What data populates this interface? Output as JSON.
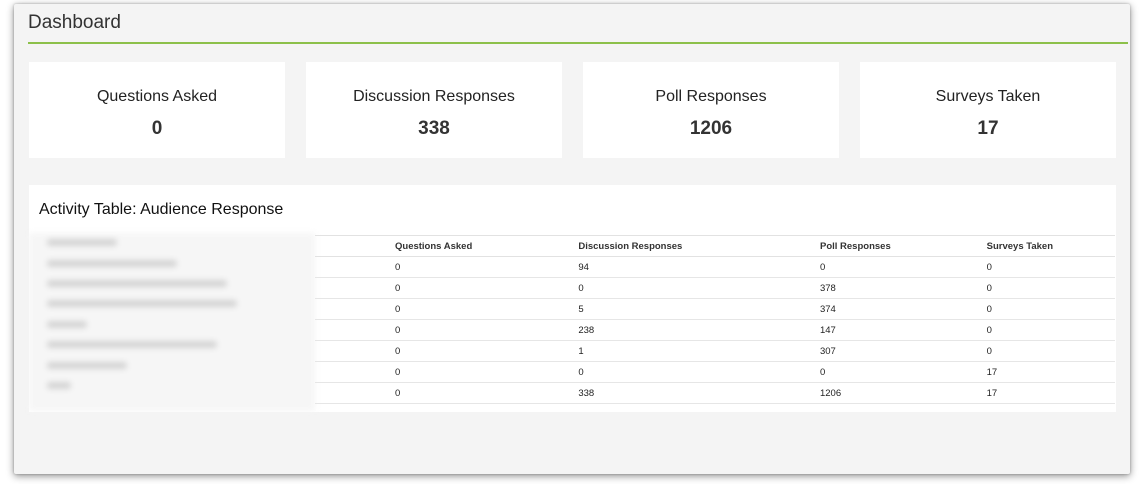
{
  "header": {
    "title": "Dashboard"
  },
  "stats": [
    {
      "label": "Questions Asked",
      "value": "0"
    },
    {
      "label": "Discussion Responses",
      "value": "338"
    },
    {
      "label": "Poll Responses",
      "value": "1206"
    },
    {
      "label": "Surveys Taken",
      "value": "17"
    }
  ],
  "activity_table": {
    "title": "Activity Table: Audience Response",
    "columns": [
      "Questions Asked",
      "Discussion Responses",
      "Poll Responses",
      "Surveys Taken"
    ],
    "rows": [
      [
        "0",
        "94",
        "0",
        "0"
      ],
      [
        "0",
        "0",
        "378",
        "0"
      ],
      [
        "0",
        "5",
        "374",
        "0"
      ],
      [
        "0",
        "238",
        "147",
        "0"
      ],
      [
        "0",
        "1",
        "307",
        "0"
      ],
      [
        "0",
        "0",
        "0",
        "17"
      ],
      [
        "0",
        "338",
        "1206",
        "17"
      ]
    ]
  },
  "colors": {
    "accent_underline": "#8cc04a",
    "background": "#f4f4f4",
    "card": "#ffffff"
  }
}
